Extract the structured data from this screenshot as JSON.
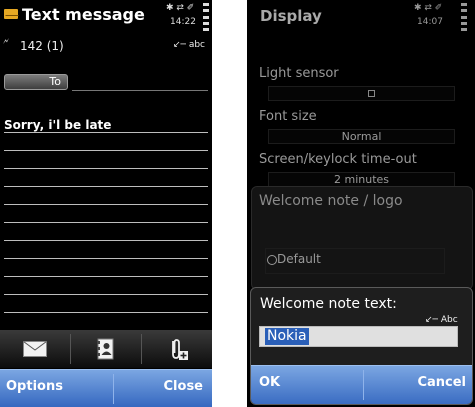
{
  "left": {
    "title": "Text message",
    "char_counter": "142 (1)",
    "status": {
      "icons": "✱ ⇄ ✐",
      "time": "14:22"
    },
    "input_mode": "abc",
    "to_button_label": "To",
    "message_text": "Sorry, i'l be late",
    "toolbar": {
      "items": [
        {
          "icon": "envelope-icon"
        },
        {
          "icon": "contacts-icon"
        },
        {
          "icon": "attachment-icon"
        }
      ]
    },
    "softkeys": {
      "left": "Options",
      "right": "Close"
    }
  },
  "right": {
    "title": "Display",
    "status": {
      "icons": "✱ ⇄ ✐",
      "time": "14:07"
    },
    "settings": {
      "light_sensor_label": "Light sensor",
      "font_size_label": "Font size",
      "font_size_value": "Normal",
      "timeout_label": "Screen/keylock time-out",
      "timeout_value": "2 minutes",
      "welcome_label": "Welcome note / logo",
      "welcome_option": "Default"
    },
    "dialog": {
      "title": "Welcome note text:",
      "input_mode": "Abc",
      "input_value": "Nokia",
      "ok_label": "OK",
      "cancel_label": "Cancel"
    }
  },
  "colors": {
    "softkey_bar": "#3568c0",
    "envelope": "#e6a823",
    "selection": "#2a5fb8"
  }
}
